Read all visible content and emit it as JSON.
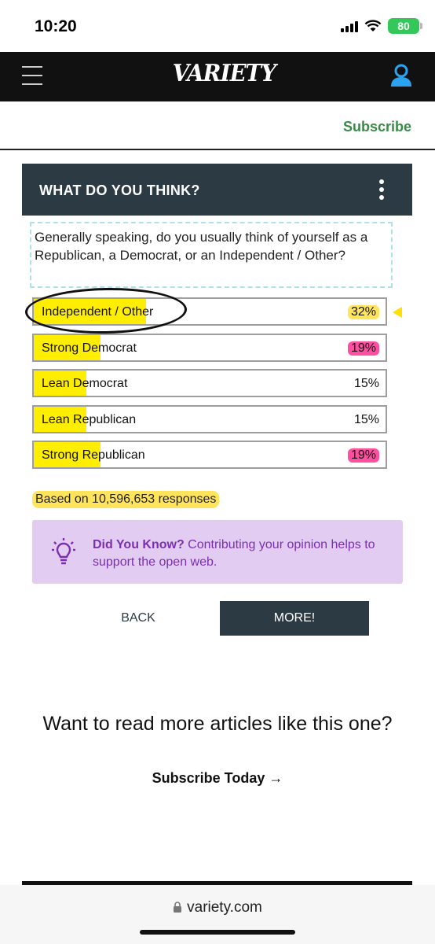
{
  "status_bar": {
    "time": "10:20",
    "battery": "80"
  },
  "header": {
    "logo": "VARIETY",
    "subscribe_label": "Subscribe"
  },
  "poll": {
    "title": "WHAT DO YOU THINK?",
    "question": "Generally speaking, do you usually think of yourself as a Republican, a Democrat, or an Independent / Other?",
    "options": [
      {
        "label": "Independent / Other",
        "percent": "32%",
        "value": 32
      },
      {
        "label": "Strong Democrat",
        "percent": "19%",
        "value": 19
      },
      {
        "label": "Lean Democrat",
        "percent": "15%",
        "value": 15
      },
      {
        "label": "Lean Republican",
        "percent": "15%",
        "value": 15
      },
      {
        "label": "Strong Republican",
        "percent": "19%",
        "value": 19
      }
    ],
    "responses": "Based on 10,596,653 responses"
  },
  "did_you_know": {
    "heading": "Did You Know?",
    "body": " Contributing your opinion helps to support the open web."
  },
  "buttons": {
    "back": "BACK",
    "more": "MORE!"
  },
  "promo": {
    "heading": "Want to read more articles like this one?",
    "cta": "Subscribe Today",
    "cta_arrow": "→"
  },
  "browser": {
    "url": "variety.com"
  },
  "colors": {
    "header_bg": "#111111",
    "poll_header_bg": "#2c3a44",
    "bar_fill": "#ffee00",
    "subscribe_green": "#3a8a48",
    "did_you_know_bg": "#e2ccf2",
    "did_you_know_text": "#7b2fb0",
    "highlight_yellow": "#ffe45c",
    "highlight_pink": "#ff4fa0"
  }
}
